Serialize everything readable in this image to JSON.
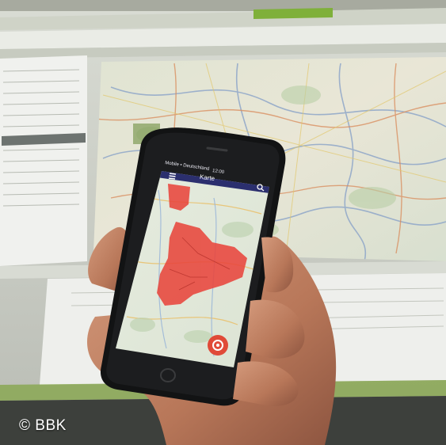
{
  "photo": {
    "subject": "hand-holding-smartphone-in-front-of-monitor",
    "phone": {
      "status_carrier": "Mobile • Deutschland",
      "status_time": "12:00",
      "status_battery": "▮",
      "app_title": "Karte",
      "menu_icon": "hamburger-icon",
      "search_icon": "search-icon",
      "location_button_icon": "target-icon",
      "alert_color": "#e8463c",
      "header_color": "#2b2f6e"
    },
    "monitor": {
      "top_tab_label": "",
      "accent_color": "#7fb03a"
    }
  },
  "credit": {
    "text": "© BBK"
  }
}
